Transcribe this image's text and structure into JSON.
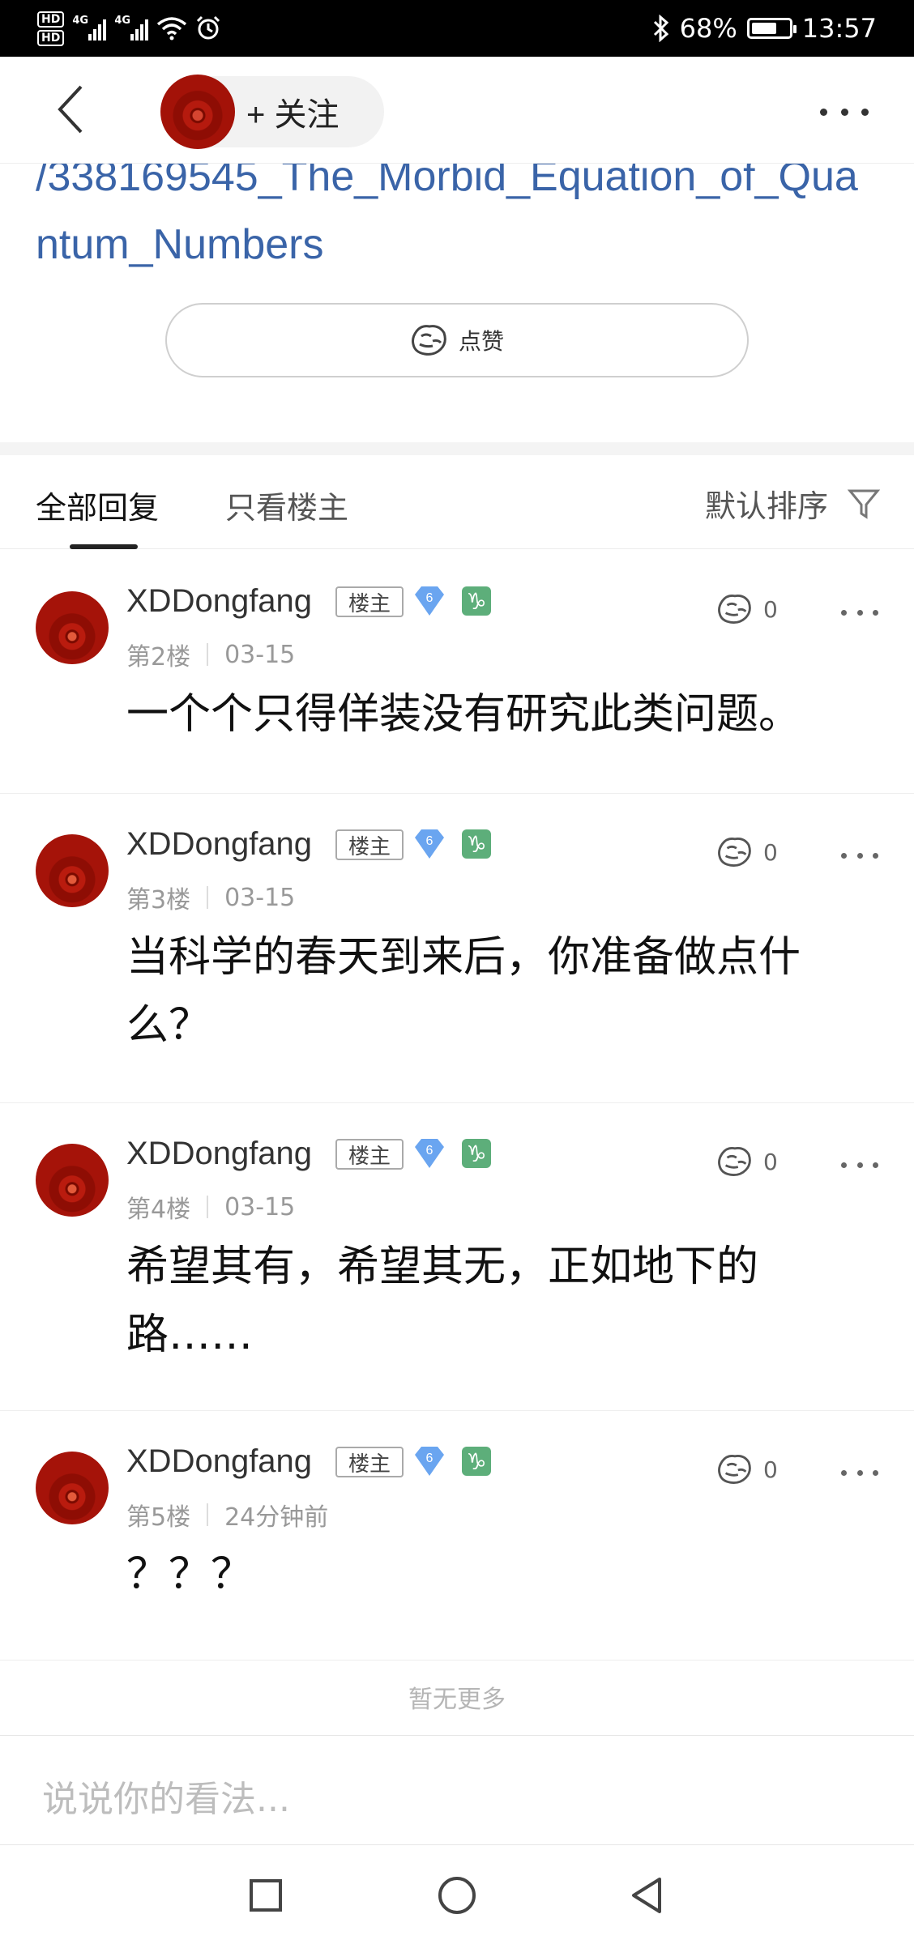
{
  "status_bar": {
    "hd1": "HD",
    "hd2": "HD",
    "sig1_label": "4G",
    "sig2_label": "4G",
    "battery_percent": "68%",
    "battery_level": 0.68,
    "time": "13:57"
  },
  "nav": {
    "follow_label": "+ 关注",
    "icons": {
      "back": "chevron-left-icon",
      "more": "more-icon"
    }
  },
  "post": {
    "link_text": "/338169545_The_Morbid_Equation_of_Quantum_Numbers",
    "like_label": "点赞"
  },
  "tabs": {
    "all": "全部回复",
    "only_op": "只看楼主",
    "sort": "默认排序"
  },
  "replies": [
    {
      "name": "XDDongfang",
      "badge": "楼主",
      "level": "6",
      "zodiac": "♑",
      "floor": "第2楼",
      "time": "03-15",
      "likes": "0",
      "content": "一个个只得佯装没有研究此类问题。"
    },
    {
      "name": "XDDongfang",
      "badge": "楼主",
      "level": "6",
      "zodiac": "♑",
      "floor": "第3楼",
      "time": "03-15",
      "likes": "0",
      "content": "当科学的春天到来后，你准备做点什么？"
    },
    {
      "name": "XDDongfang",
      "badge": "楼主",
      "level": "6",
      "zodiac": "♑",
      "floor": "第4楼",
      "time": "03-15",
      "likes": "0",
      "content": "希望其有，希望其无，正如地下的路……"
    },
    {
      "name": "XDDongfang",
      "badge": "楼主",
      "level": "6",
      "zodiac": "♑",
      "floor": "第5楼",
      "time": "24分钟前",
      "likes": "0",
      "content": "？？？"
    }
  ],
  "footer": {
    "no_more": "暂无更多",
    "input_placeholder": "说说你的看法..."
  },
  "colors": {
    "link": "#3a64a8",
    "zodiac_badge": "#5dae7a",
    "level_badge": "#6aa5f0"
  }
}
